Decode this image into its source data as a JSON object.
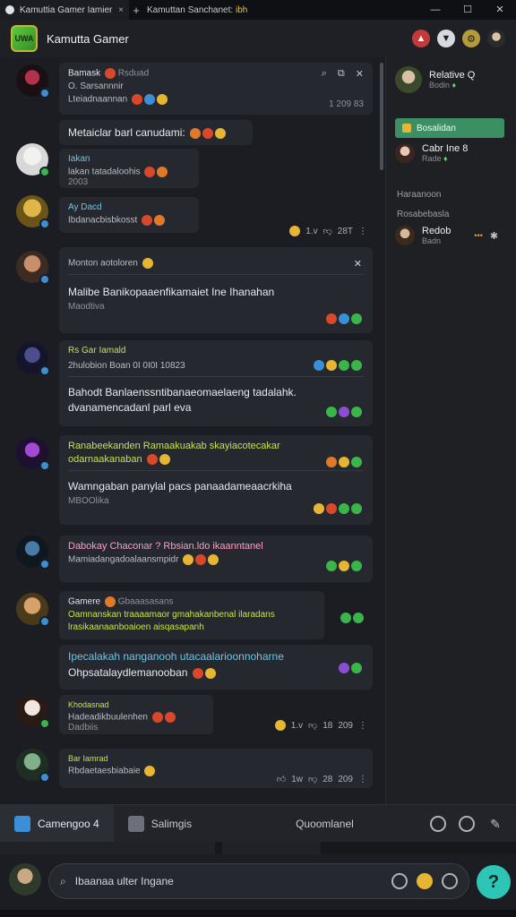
{
  "window": {
    "tab_title": "Kamuttia Gamer Iamier",
    "tab2_prefix": "Kamuttan Sanchanet:",
    "tab2_highlight": "ibh",
    "minimize": "—",
    "maximize": "☐",
    "close": "✕"
  },
  "header": {
    "title": "Kamutta Gamer",
    "logo_text": "UWA"
  },
  "messages": [
    {
      "name": "Bamask",
      "sub_name": "Rsduad",
      "line1": "O. Sarsannnir",
      "line2": "Lteiadnaannan",
      "meta": "1 209 83"
    },
    {
      "body": "Metaiclar barl canudami:"
    },
    {
      "name": "Iakan",
      "text": "lakan tatadaloohis",
      "meta": "2003"
    },
    {
      "name": "Ay Dacd",
      "text": "Ibdanacbisbkosst",
      "reacts": [
        "1.v",
        "28T"
      ]
    },
    {
      "title": "Monton aotoloren",
      "body": "Malibe Banikopaaenfikamaiet Ine Ihanahan",
      "sub": "Maodtiva"
    },
    {
      "name": "Rs Gar Iamald",
      "line": "2hulobion   Boan 0I   0I0I   10823",
      "body": "Bahodt Banlaenssntibanaeomaelaeng tadalahk.",
      "body2": "dvanamencadanl parl eva"
    },
    {
      "title": "Ranabeekanden Ramaakuakab skayiacotecakar",
      "title2": "odarnaakanaban",
      "body": "Wamngaban panylal pacs panaadameaacrkiha",
      "sub": "MBOOlika"
    },
    {
      "title": "Dabokay Chaconar ? Rbsian.ldo ikaanntanel",
      "sub": "Mamiadangadoalaansmpidr"
    },
    {
      "name": "Gamere",
      "sub_name": "Gbaaasasans",
      "line1": "Oamnanskan traaaamaor gmahakanbenal ilaradans",
      "line2": "lrasikaanaanboaioen aisqasapanh",
      "body": "Ipecalakah nanganooh utacaalarioonnoharne",
      "body2": "Ohpsatalaydlemanooban"
    },
    {
      "name": "Khodasnad",
      "text": "Hadeadikbuulenhen",
      "sub": "Dadbiis",
      "reacts": [
        "1.v",
        "18",
        "209"
      ]
    },
    {
      "name": "Bar Iamrad",
      "text": "Rbdaetaesbiabaie",
      "reacts": [
        "1w",
        "28",
        "209"
      ]
    }
  ],
  "right_panel": {
    "user_name": "Relative Q",
    "user_sub": "Bodin",
    "active_item": "Bosalidan",
    "item1_name": "Cabr Ine 8",
    "item1_sub": "Rade",
    "section1": "Haraanoon",
    "section2": "Rosabebasla",
    "item2_name": "Redob",
    "item2_sub": "Badn"
  },
  "tabs": [
    {
      "label": "Camengoo 4"
    },
    {
      "label": "Salimgis"
    },
    {
      "label": "Quoomlanel"
    }
  ],
  "composer": {
    "placeholder": "Ibaanaa ulter Ingane",
    "help": "?"
  },
  "colors": {
    "accent_green": "#3b8f63",
    "help_button": "#2ec4b6",
    "lime_text": "#c6e34a"
  }
}
